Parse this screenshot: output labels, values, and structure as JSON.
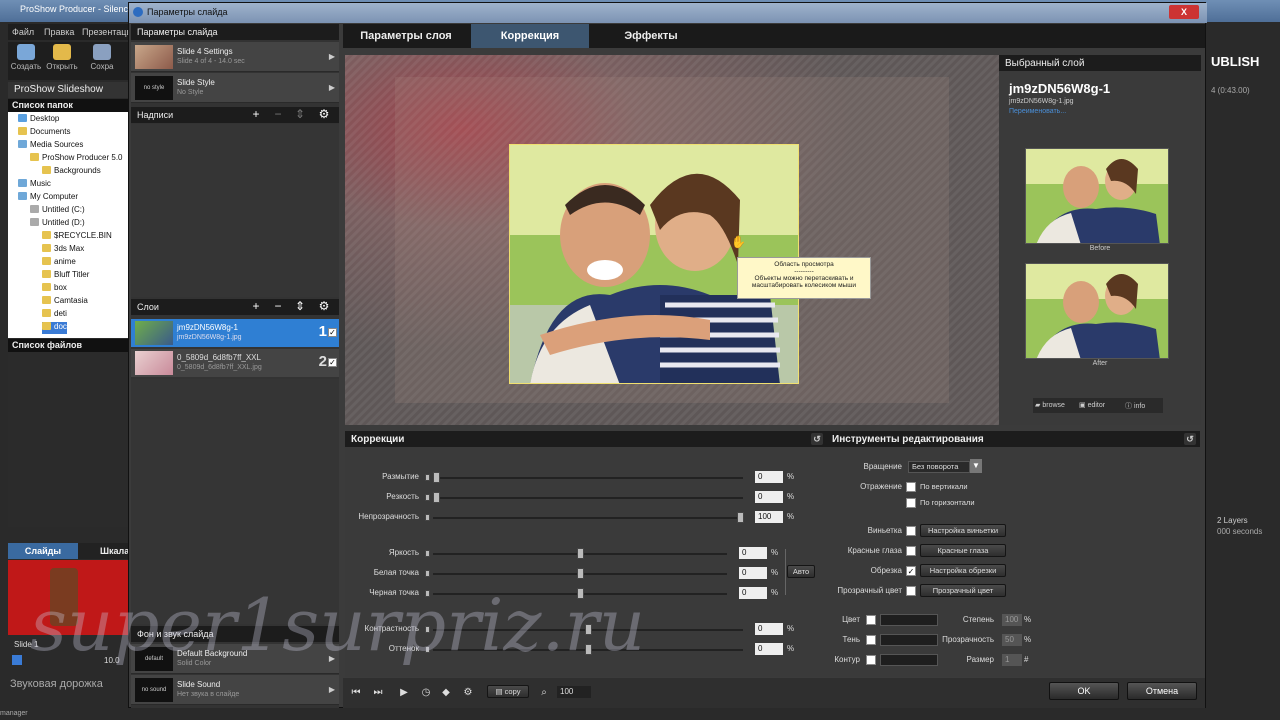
{
  "bg_app": {
    "title": "ProShow Producer - Silence",
    "menu": [
      "Файл",
      "Правка",
      "Презентация"
    ],
    "toolbar": {
      "create": "Создать",
      "open": "Открыть",
      "save": "Сохра"
    },
    "project_title": "ProShow Slideshow",
    "folders_header": "Список папок",
    "tree": [
      "Desktop",
      "Documents",
      "Media Sources",
      "ProShow Producer 5.0",
      "Backgrounds",
      "Music",
      "My Computer",
      "Untitled (C:)",
      "Untitled (D:)",
      "$RECYCLE.BIN",
      "3ds Max",
      "anime",
      "Bluff Titler",
      "box",
      "Camtasia",
      "deti",
      "doc"
    ],
    "files_header": "Список файлов",
    "tab_slides": "Слайды",
    "tab_timeline": "Шкала",
    "slide_label": "Slide 1",
    "slide_time": "10.0",
    "sound_label": "Звуковая дорожка",
    "publish": "UBLISH",
    "right_info": "4 (0:43.00)",
    "layers_info": "2 Layers",
    "seconds": "000 seconds",
    "status": "manager"
  },
  "dialog": {
    "title": "Параметры слайда",
    "close": "X",
    "left": {
      "slide_params_header": "Параметры слайда",
      "slide_settings_title": "Slide 4 Settings",
      "slide_settings_sub": "Slide 4 of 4 - 14.0 sec",
      "style_thumb": "no style",
      "slide_style_title": "Slide Style",
      "slide_style_sub": "No Style",
      "captions_header": "Надписи",
      "layers_header": "Слои",
      "layers": [
        {
          "name": "jm9zDN56W8g-1",
          "file": "jm9zDN56W8g-1.jpg",
          "num": "1",
          "checked": "✓"
        },
        {
          "name": "0_5809d_6d8fb7ff_XXL",
          "file": "0_5809d_6d8fb7ff_XXL.jpg",
          "num": "2",
          "checked": "✓"
        }
      ],
      "bg_sound_header": "Фон и звук слайда",
      "bg_thumb": "default",
      "bg_title": "Default Background",
      "bg_sub": "Solid Color",
      "sound_thumb": "no sound",
      "sound_title": "Slide Sound",
      "sound_sub": "Нет звука в слайде"
    },
    "tabs": [
      "Параметры слоя",
      "Коррекция",
      "Эффекты"
    ],
    "preview": {
      "tooltip_title": "Область просмотра",
      "tooltip_sep": "---------",
      "tooltip_body": "Объекты можно перетаскивать и масштабировать колесиком мыши"
    },
    "selected_layer": {
      "header": "Выбранный слой",
      "name": "jm9zDN56W8g-1",
      "file": "jm9zDN56W8g-1.jpg",
      "rename": "Переименовать...",
      "before": "Before",
      "after": "After",
      "browse": "browse",
      "editor": "editor",
      "info": "info"
    },
    "corrections": {
      "header": "Коррекции",
      "rows": [
        {
          "label": "Размытие",
          "value": "0",
          "unit": "%",
          "level": 0.0
        },
        {
          "label": "Резкость",
          "value": "0",
          "unit": "%",
          "level": 0.0
        },
        {
          "label": "Непрозрачность",
          "value": "100",
          "unit": "%",
          "level": 1.0
        },
        {
          "label": "Яркость",
          "value": "0",
          "unit": "%",
          "level": 0.5
        },
        {
          "label": "Белая точка",
          "value": "0",
          "unit": "%",
          "level": 0.5
        },
        {
          "label": "Черная точка",
          "value": "0",
          "unit": "%",
          "level": 0.5
        },
        {
          "label": "Контрастность",
          "value": "0",
          "unit": "%",
          "level": 0.5
        },
        {
          "label": "Оттенок",
          "value": "0",
          "unit": "%",
          "level": 0.5
        }
      ],
      "auto": "Авто"
    },
    "tools": {
      "header": "Инструменты редактирования",
      "rotation_label": "Вращение",
      "rotation_value": "Без поворота",
      "flip_label": "Отражение",
      "flip_v": "По вертикали",
      "flip_h": "По горизонтали",
      "vignette_label": "Виньетка",
      "vignette_btn": "Настройка виньетки",
      "redeye_label": "Красные глаза",
      "redeye_btn": "Красные глаза",
      "crop_label": "Обрезка",
      "crop_btn": "Настройка обрезки",
      "crop_checked": "✓",
      "transp_label": "Прозрачный цвет",
      "transp_btn": "Прозрачный цвет",
      "color_label": "Цвет",
      "shadow_label": "Тень",
      "outline_label": "Контур",
      "degree_label": "Степень",
      "degree_value": "100",
      "degree_unit": "%",
      "opacity_label": "Прозрачность",
      "opacity_value": "50",
      "opacity_unit": "%",
      "size_label": "Размер",
      "size_value": "1",
      "size_unit": "#"
    },
    "bottom": {
      "copy": "copy",
      "zoom": "100",
      "ok": "OK",
      "cancel": "Отмена"
    }
  },
  "watermark": "super1surpriz.ru"
}
